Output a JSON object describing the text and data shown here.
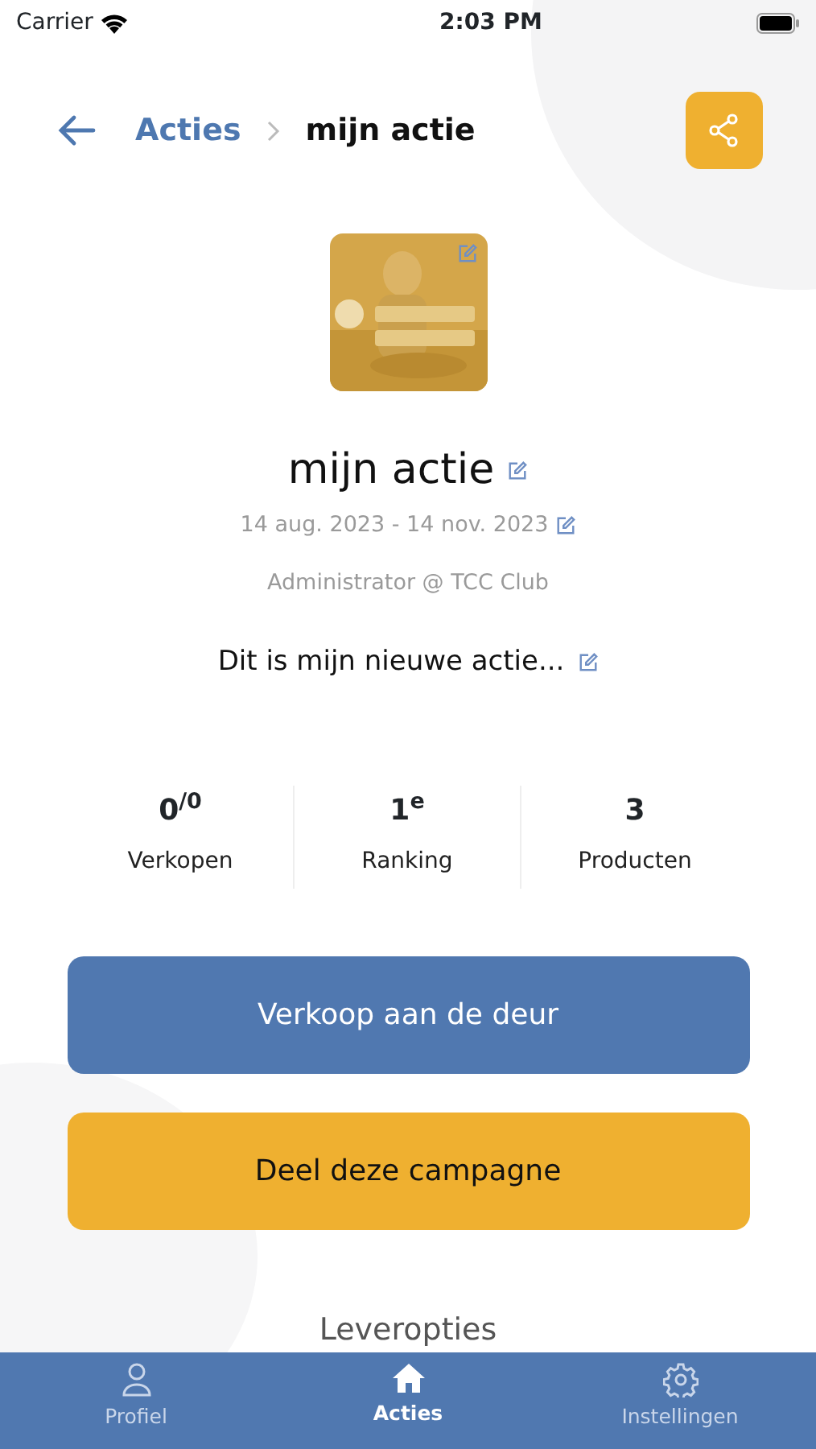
{
  "status_bar": {
    "carrier": "Carrier",
    "time": "2:03 PM"
  },
  "breadcrumb": {
    "parent": "Acties",
    "current": "mijn actie"
  },
  "campaign": {
    "title": "mijn actie",
    "dates": "14 aug. 2023 - 14 nov. 2023",
    "role": "Administrator @ TCC Club",
    "description": "Dit is mijn nieuwe actie..."
  },
  "stats": [
    {
      "value": "0$^{/0}$",
      "label": "Verkopen"
    },
    {
      "value": "1$^{e}$",
      "label": "Ranking"
    },
    {
      "value": "3",
      "label": "Producten"
    }
  ],
  "buttons": [
    {
      "label": "Verkoop aan de deur",
      "kind": "primary"
    },
    {
      "label": "Deel deze campagne",
      "kind": "secondary"
    }
  ],
  "section_title": "Leveropties",
  "tab_bar": [
    {
      "label": "Profiel",
      "kind": "profile",
      "selected": false
    },
    {
      "label": "Acties",
      "kind": "actions",
      "selected": true
    },
    {
      "label": "Instellingen",
      "kind": "settings",
      "selected": false
    }
  ]
}
